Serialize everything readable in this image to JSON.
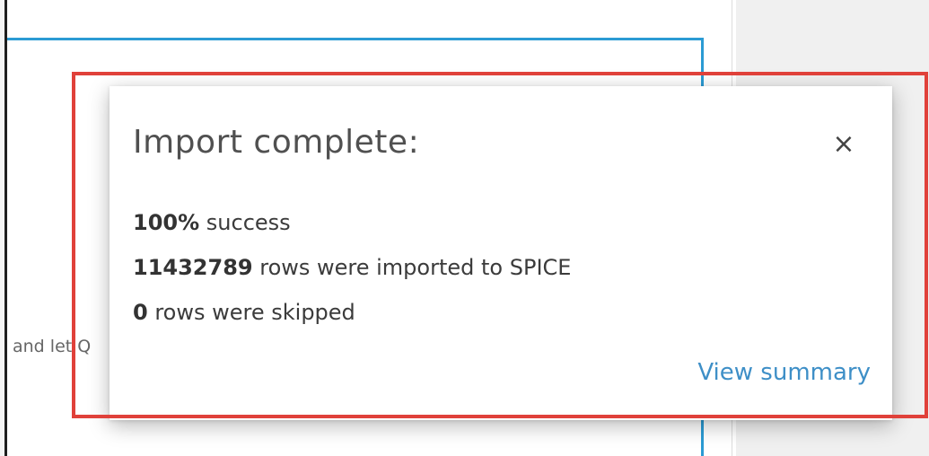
{
  "background": {
    "partial_text": "and let Q",
    "accent_color": "#2b9bd4"
  },
  "dialog": {
    "title": "Import complete:",
    "close_icon": "close-icon",
    "close_glyph": "×",
    "stats": [
      {
        "value": "100%",
        "text": " success"
      },
      {
        "value": "11432789",
        "text": " rows were imported to SPICE"
      },
      {
        "value": "0",
        "text": " rows were skipped"
      }
    ],
    "view_summary_label": "View summary",
    "link_color": "#3e8fc7"
  },
  "highlight": {
    "color": "#e0413a"
  }
}
